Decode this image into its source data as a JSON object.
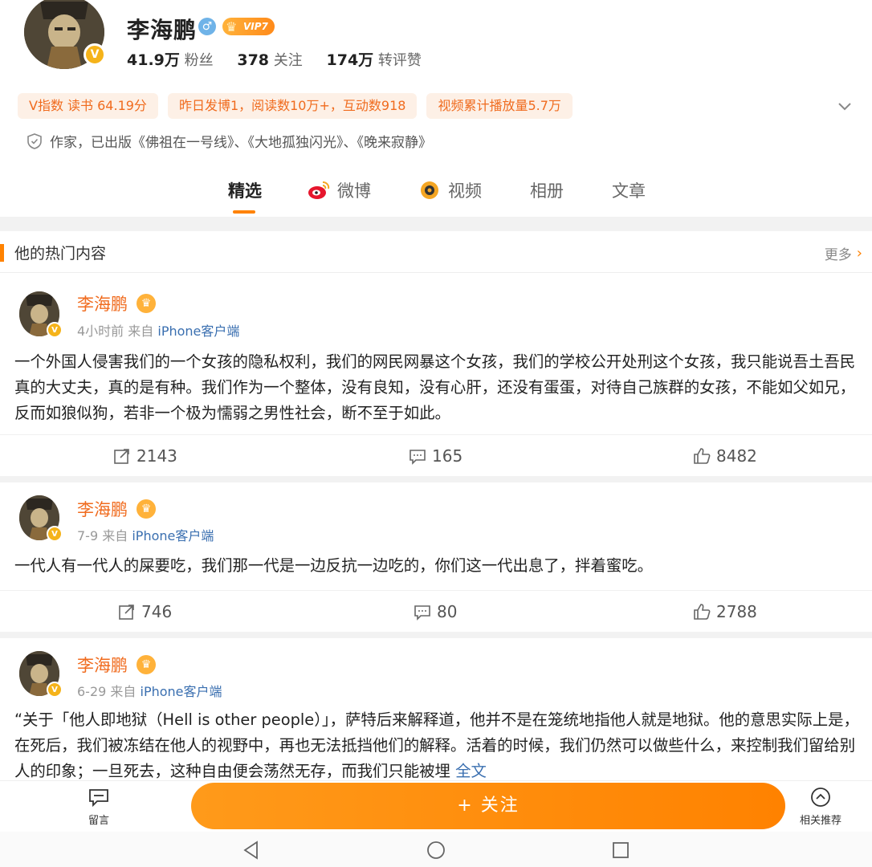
{
  "profile": {
    "name": "李海鹏",
    "vip_label": "VIP7",
    "fans_count": "41.9万",
    "fans_label": "粉丝",
    "following_count": "378",
    "following_label": "关注",
    "interactions_count": "174万",
    "interactions_label": "转评赞",
    "chips": [
      "V指数 读书 64.19分",
      "昨日发博1，阅读数10万+，互动数918",
      "视频累计播放量5.7万"
    ],
    "verification": "作家，已出版《佛祖在一号线》、《大地孤独闪光》、《晚来寂静》"
  },
  "tabs": [
    {
      "label": "精选",
      "active": true
    },
    {
      "label": "微博",
      "icon": "weibo-icon"
    },
    {
      "label": "视频",
      "icon": "video-icon"
    },
    {
      "label": "相册"
    },
    {
      "label": "文章"
    }
  ],
  "hot": {
    "title": "他的热门内容",
    "more_label": "更多"
  },
  "posts": [
    {
      "author": "李海鹏",
      "time": "4小时前",
      "from": "来自",
      "source": "iPhone客户端",
      "text": "一个外国人侵害我们的一个女孩的隐私权利，我们的网民网暴这个女孩，我们的学校公开处刑这个女孩，我只能说吾土吾民真的大丈夫，真的是有种。我们作为一个整体，没有良知，没有心肝，还没有蛋蛋，对待自己族群的女孩，不能如父如兄，反而如狼似狗，若非一个极为懦弱之男性社会，断不至于如此。",
      "reposts": "2143",
      "comments": "165",
      "likes": "8482"
    },
    {
      "author": "李海鹏",
      "time": "7-9",
      "from": "来自",
      "source": "iPhone客户端",
      "text": "一代人有一代人的屎要吃，我们那一代是一边反抗一边吃的，你们这一代出息了，拌着蜜吃。",
      "reposts": "746",
      "comments": "80",
      "likes": "2788"
    },
    {
      "author": "李海鹏",
      "time": "6-29",
      "from": "来自",
      "source": "iPhone客户端",
      "text": "“关于「他人即地狱（Hell is other people）」，萨特后来解释道，他并不是在笼统地指他人就是地狱。他的意思实际上是，在死后，我们被冻结在他人的视野中，再也无法抵挡他们的解释。活着的时候，我们仍然可以做些什么，来控制我们留给别人的印象；一旦死去，这种自由便会荡然无存，而我们只能被埋",
      "full_text_label": "全文"
    }
  ],
  "bottom": {
    "message_label": "留言",
    "follow_label": "+ 关注",
    "related_label": "相关推荐"
  },
  "colors": {
    "accent": "#ff8200",
    "name_orange": "#f06b1e",
    "link_blue": "#3a6fb0"
  }
}
